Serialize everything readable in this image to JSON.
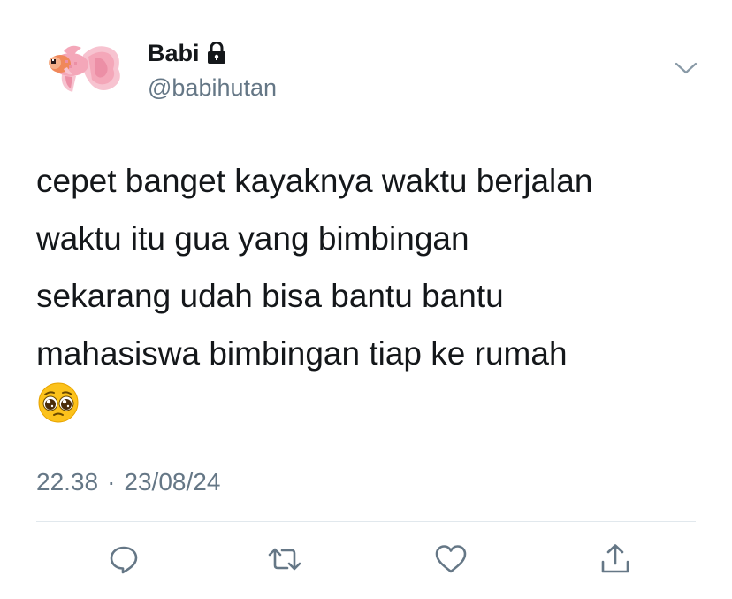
{
  "tweet": {
    "display_name": "Babi",
    "handle": "@babihutan",
    "text": "cepet banget kayaknya waktu berjalan\nwaktu itu gua yang bimbingan\nsekarang udah bisa bantu bantu\nmahasiswa bimbingan tiap ke rumah",
    "emoji": "pleading-face",
    "time": "22.38",
    "separator": "·",
    "date": "23/08/24"
  },
  "icons": {
    "avatar": "pink-betta-fish",
    "protected": "lock-icon",
    "more": "chevron-down-icon",
    "actions": [
      "reply-icon",
      "retweet-icon",
      "like-icon",
      "share-icon"
    ]
  },
  "colors": {
    "text": "#14171a",
    "secondary": "#657786",
    "divider": "#e1e8ed",
    "icon": "#657786",
    "avatar_pink": "#f4a7b9",
    "avatar_orange": "#f0885a"
  }
}
